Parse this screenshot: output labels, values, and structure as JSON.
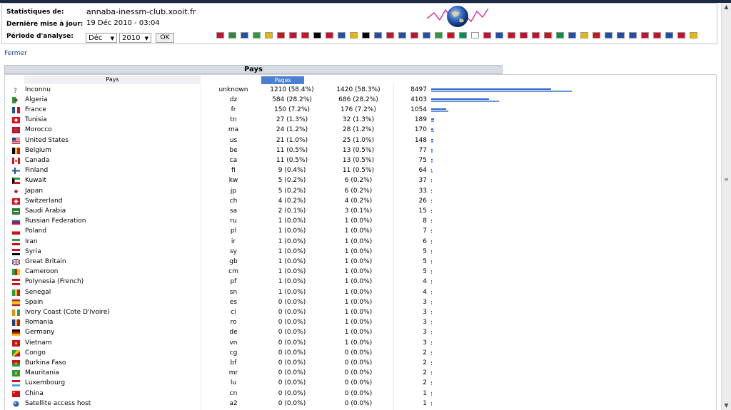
{
  "header": {
    "stats_label": "Statistiques de:",
    "stats_value": "annaba-inessm-club.xooit.fr",
    "update_label": "Dernière mise à jour:",
    "update_value": "19 Déc 2010 - 03:04",
    "period_label": "Période d'analyse:",
    "month": "Déc",
    "year": "2010",
    "ok_label": "OK"
  },
  "fermer": "Fermer",
  "table": {
    "title": "Pays",
    "col_pays": "Pays",
    "col_pages": "Pages",
    "max_value": 1420,
    "rows": [
      {
        "name": "Inconnu",
        "code": "unknown",
        "pages": "1210 (58.4%)",
        "hits": "1420 (58.3%)",
        "bw": "8497",
        "p": 1210,
        "h": 1420,
        "icon": "unknown"
      },
      {
        "name": "Algeria",
        "code": "dz",
        "pages": "584 (28.2%)",
        "hits": "686 (28.2%)",
        "bw": "4103",
        "p": 584,
        "h": 686
      },
      {
        "name": "France",
        "code": "fr",
        "pages": "150 (7.2%)",
        "hits": "176 (7.2%)",
        "bw": "1054",
        "p": 150,
        "h": 176
      },
      {
        "name": "Tunisia",
        "code": "tn",
        "pages": "27 (1.3%)",
        "hits": "32 (1.3%)",
        "bw": "189",
        "p": 27,
        "h": 32
      },
      {
        "name": "Morocco",
        "code": "ma",
        "pages": "24 (1.2%)",
        "hits": "28 (1.2%)",
        "bw": "170",
        "p": 24,
        "h": 28
      },
      {
        "name": "United States",
        "code": "us",
        "pages": "21 (1.0%)",
        "hits": "25 (1.0%)",
        "bw": "148",
        "p": 21,
        "h": 25
      },
      {
        "name": "Belgium",
        "code": "be",
        "pages": "11 (0.5%)",
        "hits": "13 (0.5%)",
        "bw": "77",
        "p": 11,
        "h": 13
      },
      {
        "name": "Canada",
        "code": "ca",
        "pages": "11 (0.5%)",
        "hits": "13 (0.5%)",
        "bw": "75",
        "p": 11,
        "h": 13
      },
      {
        "name": "Finland",
        "code": "fi",
        "pages": "9 (0.4%)",
        "hits": "11 (0.5%)",
        "bw": "64",
        "p": 9,
        "h": 11
      },
      {
        "name": "Kuwait",
        "code": "kw",
        "pages": "5 (0.2%)",
        "hits": "6 (0.2%)",
        "bw": "37",
        "p": 5,
        "h": 6
      },
      {
        "name": "Japan",
        "code": "jp",
        "pages": "5 (0.2%)",
        "hits": "6 (0.2%)",
        "bw": "33",
        "p": 5,
        "h": 6
      },
      {
        "name": "Switzerland",
        "code": "ch",
        "pages": "4 (0.2%)",
        "hits": "4 (0.2%)",
        "bw": "26",
        "p": 4,
        "h": 4
      },
      {
        "name": "Saudi Arabia",
        "code": "sa",
        "pages": "2 (0.1%)",
        "hits": "3 (0.1%)",
        "bw": "15",
        "p": 2,
        "h": 3
      },
      {
        "name": "Russian Federation",
        "code": "ru",
        "pages": "1 (0.0%)",
        "hits": "1 (0.0%)",
        "bw": "8",
        "p": 1,
        "h": 1
      },
      {
        "name": "Poland",
        "code": "pl",
        "pages": "1 (0.0%)",
        "hits": "1 (0.0%)",
        "bw": "7",
        "p": 1,
        "h": 1
      },
      {
        "name": "Iran",
        "code": "ir",
        "pages": "1 (0.0%)",
        "hits": "1 (0.0%)",
        "bw": "6",
        "p": 1,
        "h": 1
      },
      {
        "name": "Syria",
        "code": "sy",
        "pages": "1 (0.0%)",
        "hits": "1 (0.0%)",
        "bw": "5",
        "p": 1,
        "h": 1
      },
      {
        "name": "Great Britain",
        "code": "gb",
        "pages": "1 (0.0%)",
        "hits": "1 (0.0%)",
        "bw": "5",
        "p": 1,
        "h": 1
      },
      {
        "name": "Cameroon",
        "code": "cm",
        "pages": "1 (0.0%)",
        "hits": "1 (0.0%)",
        "bw": "5",
        "p": 1,
        "h": 1
      },
      {
        "name": "Polynesia (French)",
        "code": "pf",
        "pages": "1 (0.0%)",
        "hits": "1 (0.0%)",
        "bw": "4",
        "p": 1,
        "h": 1
      },
      {
        "name": "Senegal",
        "code": "sn",
        "pages": "1 (0.0%)",
        "hits": "1 (0.0%)",
        "bw": "4",
        "p": 1,
        "h": 1
      },
      {
        "name": "Spain",
        "code": "es",
        "pages": "0 (0.0%)",
        "hits": "1 (0.0%)",
        "bw": "3",
        "p": 0,
        "h": 1
      },
      {
        "name": "Ivory Coast (Cote D'Ivoire)",
        "code": "ci",
        "pages": "0 (0.0%)",
        "hits": "1 (0.0%)",
        "bw": "3",
        "p": 0,
        "h": 1
      },
      {
        "name": "Romania",
        "code": "ro",
        "pages": "0 (0.0%)",
        "hits": "1 (0.0%)",
        "bw": "3",
        "p": 0,
        "h": 1
      },
      {
        "name": "Germany",
        "code": "de",
        "pages": "0 (0.0%)",
        "hits": "1 (0.0%)",
        "bw": "3",
        "p": 0,
        "h": 1
      },
      {
        "name": "Vietnam",
        "code": "vn",
        "pages": "0 (0.0%)",
        "hits": "1 (0.0%)",
        "bw": "3",
        "p": 0,
        "h": 1
      },
      {
        "name": "Congo",
        "code": "cg",
        "pages": "0 (0.0%)",
        "hits": "0 (0.0%)",
        "bw": "2",
        "p": 0,
        "h": 0
      },
      {
        "name": "Burkina Faso",
        "code": "bf",
        "pages": "0 (0.0%)",
        "hits": "0 (0.0%)",
        "bw": "2",
        "p": 0,
        "h": 0
      },
      {
        "name": "Mauritania",
        "code": "mr",
        "pages": "0 (0.0%)",
        "hits": "0 (0.0%)",
        "bw": "2",
        "p": 0,
        "h": 0
      },
      {
        "name": "Luxembourg",
        "code": "lu",
        "pages": "0 (0.0%)",
        "hits": "0 (0.0%)",
        "bw": "2",
        "p": 0,
        "h": 0
      },
      {
        "name": "China",
        "code": "cn",
        "pages": "0 (0.0%)",
        "hits": "0 (0.0%)",
        "bw": "1",
        "p": 0,
        "h": 0
      },
      {
        "name": "Satellite access host",
        "code": "a2",
        "pages": "0 (0.0%)",
        "hits": "0 (0.0%)",
        "bw": "1",
        "p": 0,
        "h": 0,
        "icon": "globe"
      }
    ]
  },
  "language_flags": [
    "#c8102e",
    "#2b8a3e",
    "#1f4fa8",
    "#2e9b3a",
    "#e6b800",
    "#d0101a",
    "#c8102e",
    "#d0101a",
    "#000000",
    "#c8102e",
    "#1f4fa8",
    "#e6b800",
    "#000000",
    "#1f4fa8",
    "#c8102e",
    "#1f4fa8",
    "#c8102e",
    "#1f4fa8",
    "#2e9b3a",
    "#d0101a",
    "#009246",
    "#ffffff",
    "#c8102e",
    "#1f4fa8",
    "#c8102e",
    "#c8102e",
    "#c8102e",
    "#d0101a",
    "#009246",
    "#1f4fa8",
    "#e6b800",
    "#d0101a",
    "#1f4fa8",
    "#1f4fa8",
    "#1f4fa8",
    "#c8102e",
    "#c8102e",
    "#1f4fa8",
    "#c8102e",
    "#e6b800"
  ]
}
